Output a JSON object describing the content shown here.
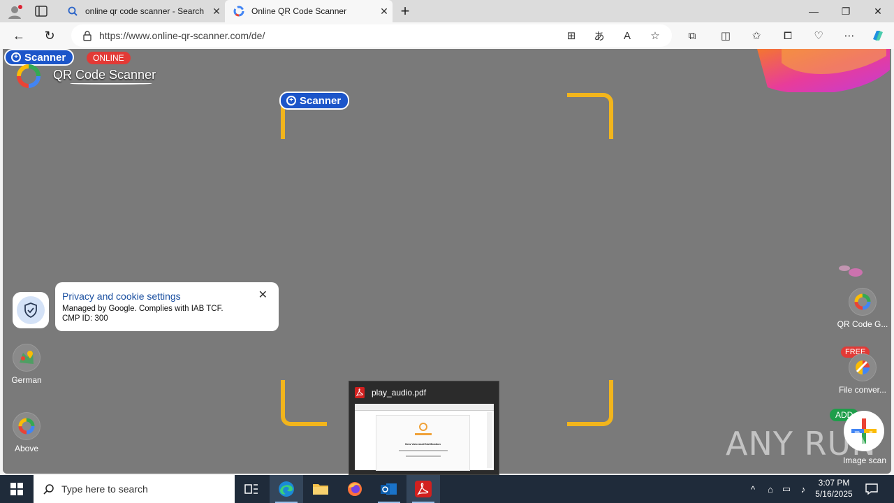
{
  "browser": {
    "tabs": [
      {
        "label": "online qr code scanner - Search",
        "icon": "bing-search-icon"
      },
      {
        "label": "Online QR Code Scanner",
        "icon": "qr-scanner-favicon"
      }
    ],
    "new_tab": "+",
    "url": "https://www.online-qr-scanner.com/de/"
  },
  "page": {
    "badge_scanner": "Scanner",
    "badge_online": "ONLINE",
    "site_title": "QR Code Scanner",
    "center_scanner": "Scanner",
    "scan_frame_color": "#f2b51c",
    "side_left": [
      {
        "label": "German",
        "icon": "map-pin-icon"
      },
      {
        "label": "Above",
        "icon": "google-logo-icon"
      }
    ],
    "side_right": [
      {
        "label": "QR Code G...",
        "icon": "qr-generator-icon"
      },
      {
        "label": "File conver...",
        "icon": "file-converter-icon",
        "badge": "FREE"
      },
      {
        "label": "Image scan",
        "icon": "add-plus-icon",
        "badge": "ADD"
      }
    ]
  },
  "cookie_popup": {
    "title": "Privacy and cookie settings",
    "line1": "Managed by Google. Complies with IAB TCF.",
    "line2": "CMP ID: 300"
  },
  "taskbar_preview": {
    "title": "play_audio.pdf",
    "doc_heading": "New Voicemail Notification"
  },
  "watermark": "ANY RUN",
  "taskbar": {
    "search_placeholder": "Type here to search",
    "time": "3:07 PM",
    "date": "5/16/2025"
  }
}
